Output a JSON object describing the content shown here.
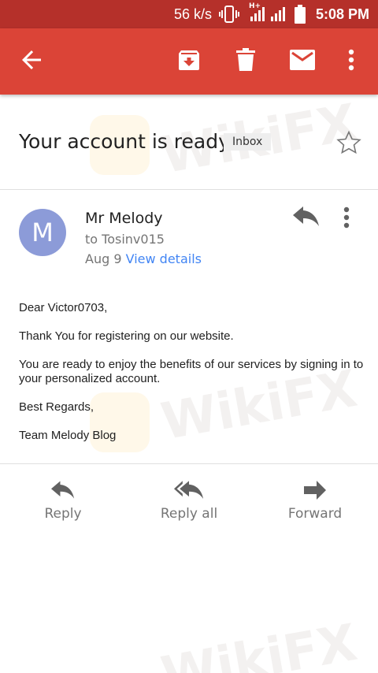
{
  "status_bar": {
    "speed": "56 k/s",
    "network": "H+",
    "time": "5:08 PM"
  },
  "toolbar": {
    "back_icon": "arrow-left-icon",
    "archive_icon": "archive-icon",
    "delete_icon": "trash-icon",
    "unread_icon": "envelope-icon",
    "more_icon": "more-vert-icon",
    "background_color": "#db4437"
  },
  "email": {
    "subject": "Your account is ready.",
    "label": "Inbox",
    "sender_initial": "M",
    "sender": "Mr Melody",
    "recipient": "to Tosinv015",
    "date": "Aug 9",
    "view_details": "View details",
    "body": {
      "greeting": "Dear Victor0703,",
      "line1": "Thank You for registering on our website.",
      "line2": "You are ready to enjoy the benefits of our services by signing in to your personalized account.",
      "closing": "Best Regards,",
      "signature": "Team Melody Blog"
    }
  },
  "actions": {
    "reply": "Reply",
    "reply_all": "Reply all",
    "forward": "Forward"
  },
  "watermark": "WikiFX"
}
